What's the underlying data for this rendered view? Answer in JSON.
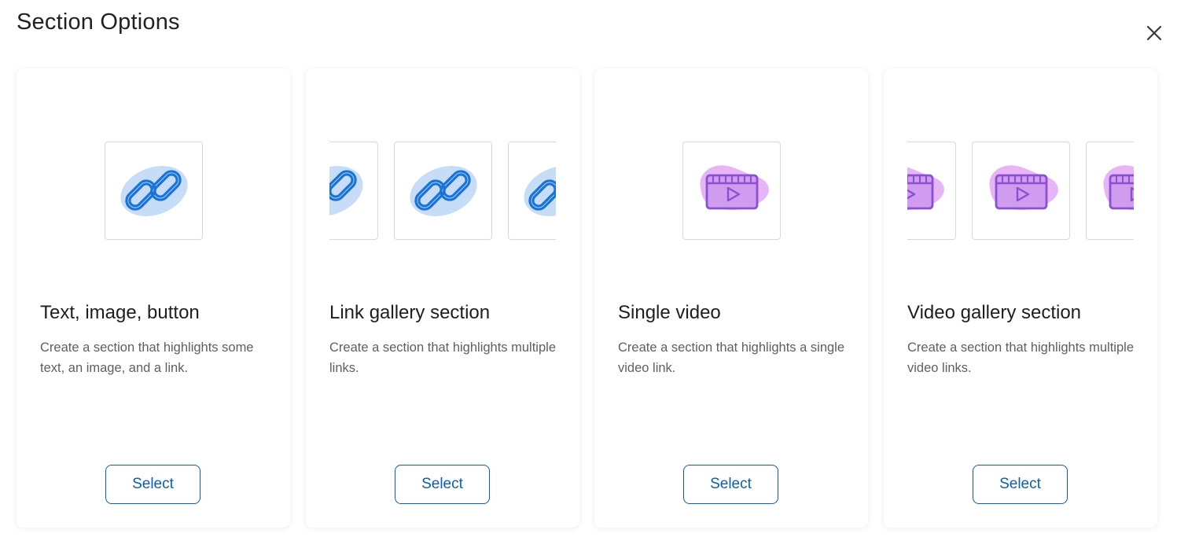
{
  "dialog": {
    "title": "Section Options",
    "close_icon": "close-icon"
  },
  "colors": {
    "accent": "#0a5fb4",
    "link_icon": "#1a73d9",
    "link_blob": "#c7ddf7",
    "video_icon": "#8b4fd1",
    "video_blob": "#e7b4f5"
  },
  "cards": [
    {
      "title": "Text, image, button",
      "description": "Create a section that highlights some text, an image, and a link.",
      "icon": "link-icon",
      "select_label": "Select"
    },
    {
      "title": "Link gallery section",
      "description": "Create a section that highlights multiple links.",
      "icon": "link-icon",
      "select_label": "Select"
    },
    {
      "title": "Single video",
      "description": "Create a section that highlights a single video link.",
      "icon": "video-icon",
      "select_label": "Select"
    },
    {
      "title": "Video gallery section",
      "description": "Create a section that highlights multiple video links.",
      "icon": "video-icon",
      "select_label": "Select"
    }
  ]
}
